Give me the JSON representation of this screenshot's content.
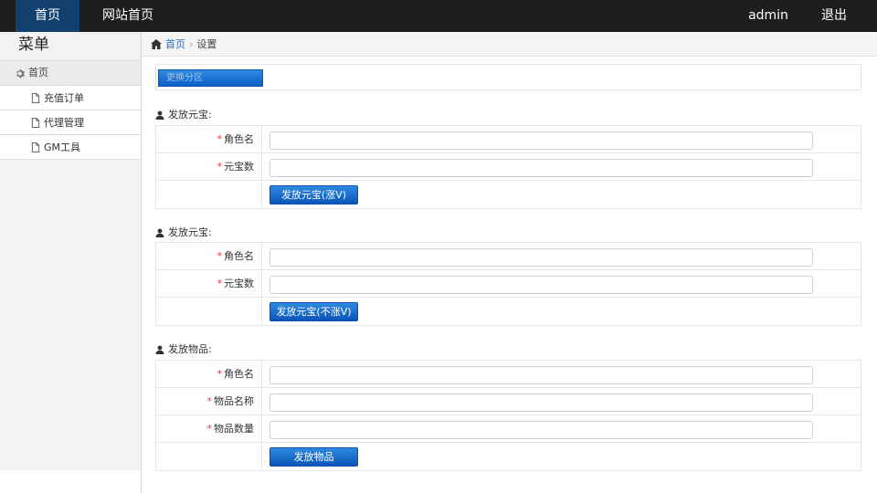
{
  "topnav": {
    "home": "首页",
    "site_home": "网站首页",
    "user": "admin",
    "logout": "退出"
  },
  "sidebar": {
    "title": "菜单",
    "home": "首页",
    "items": [
      {
        "label": "充值订单"
      },
      {
        "label": "代理管理"
      },
      {
        "label": "GM工具"
      }
    ]
  },
  "breadcrumb": {
    "home": "首页",
    "current": "设置"
  },
  "zone": {
    "button_label": "更换分区"
  },
  "sections": [
    {
      "title": "发放元宝:",
      "fields": [
        {
          "label": "角色名",
          "value": ""
        },
        {
          "label": "元宝数",
          "value": ""
        }
      ],
      "button": "发放元宝(涨V)"
    },
    {
      "title": "发放元宝:",
      "fields": [
        {
          "label": "角色名",
          "value": ""
        },
        {
          "label": "元宝数",
          "value": ""
        }
      ],
      "button": "发放元宝(不涨V)"
    },
    {
      "title": "发放物品:",
      "fields": [
        {
          "label": "角色名",
          "value": ""
        },
        {
          "label": "物品名称",
          "value": ""
        },
        {
          "label": "物品数量",
          "value": ""
        }
      ],
      "button": "发放物品"
    }
  ],
  "required_mark": "*",
  "colors": {
    "topbar": "#1e1e1e",
    "topnav_active": "#12406f",
    "button_blue": "#0e5fc5",
    "link_blue": "#2a6ebb",
    "required_red": "#e4393c"
  }
}
